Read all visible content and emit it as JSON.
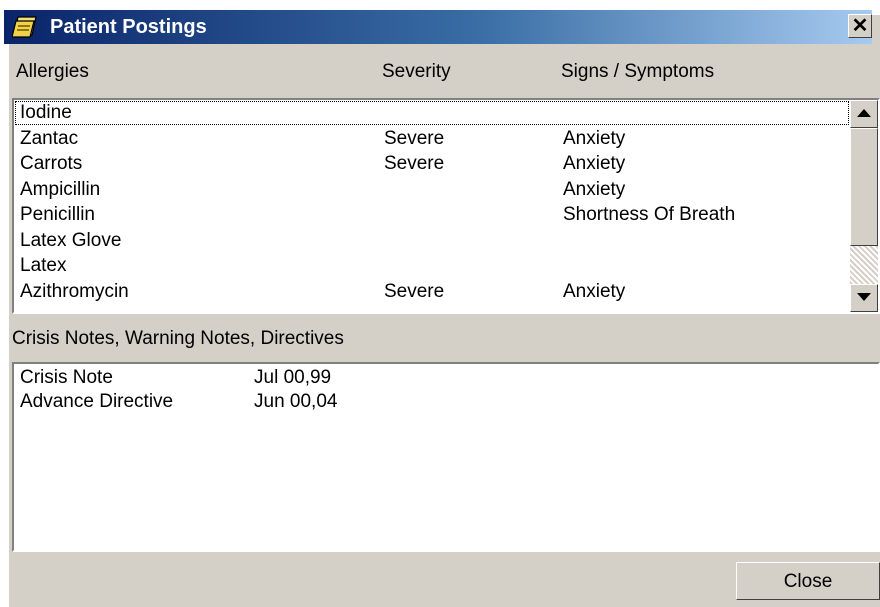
{
  "window": {
    "title": "Patient Postings",
    "close_glyph": "✕"
  },
  "allergies": {
    "headers": [
      "Allergies",
      "Severity",
      "Signs / Symptoms"
    ],
    "rows": [
      [
        "Iodine",
        "",
        ""
      ],
      [
        "Zantac",
        "Severe",
        "Anxiety"
      ],
      [
        "Carrots",
        "Severe",
        "Anxiety"
      ],
      [
        "Ampicillin",
        "",
        "Anxiety"
      ],
      [
        "Penicillin",
        "",
        "Shortness Of Breath"
      ],
      [
        "Latex Glove",
        "",
        ""
      ],
      [
        "Latex",
        "",
        ""
      ],
      [
        "Azithromycin",
        "Severe",
        "Anxiety"
      ]
    ]
  },
  "notes": {
    "header": "Crisis Notes, Warning Notes, Directives",
    "rows": [
      [
        "Crisis Note",
        "Jul 00,99"
      ],
      [
        "Advance Directive",
        "Jun 00,04"
      ]
    ]
  },
  "buttons": {
    "close_label": "Close"
  },
  "icons": {
    "title_icon": "notepad-icon",
    "scroll_up": "arrow-up-icon",
    "scroll_down": "arrow-down-icon"
  },
  "colors": {
    "titlebar_start": "#0a246a",
    "titlebar_end": "#a6caf0",
    "dialog_bg": "#d4d0c8"
  }
}
